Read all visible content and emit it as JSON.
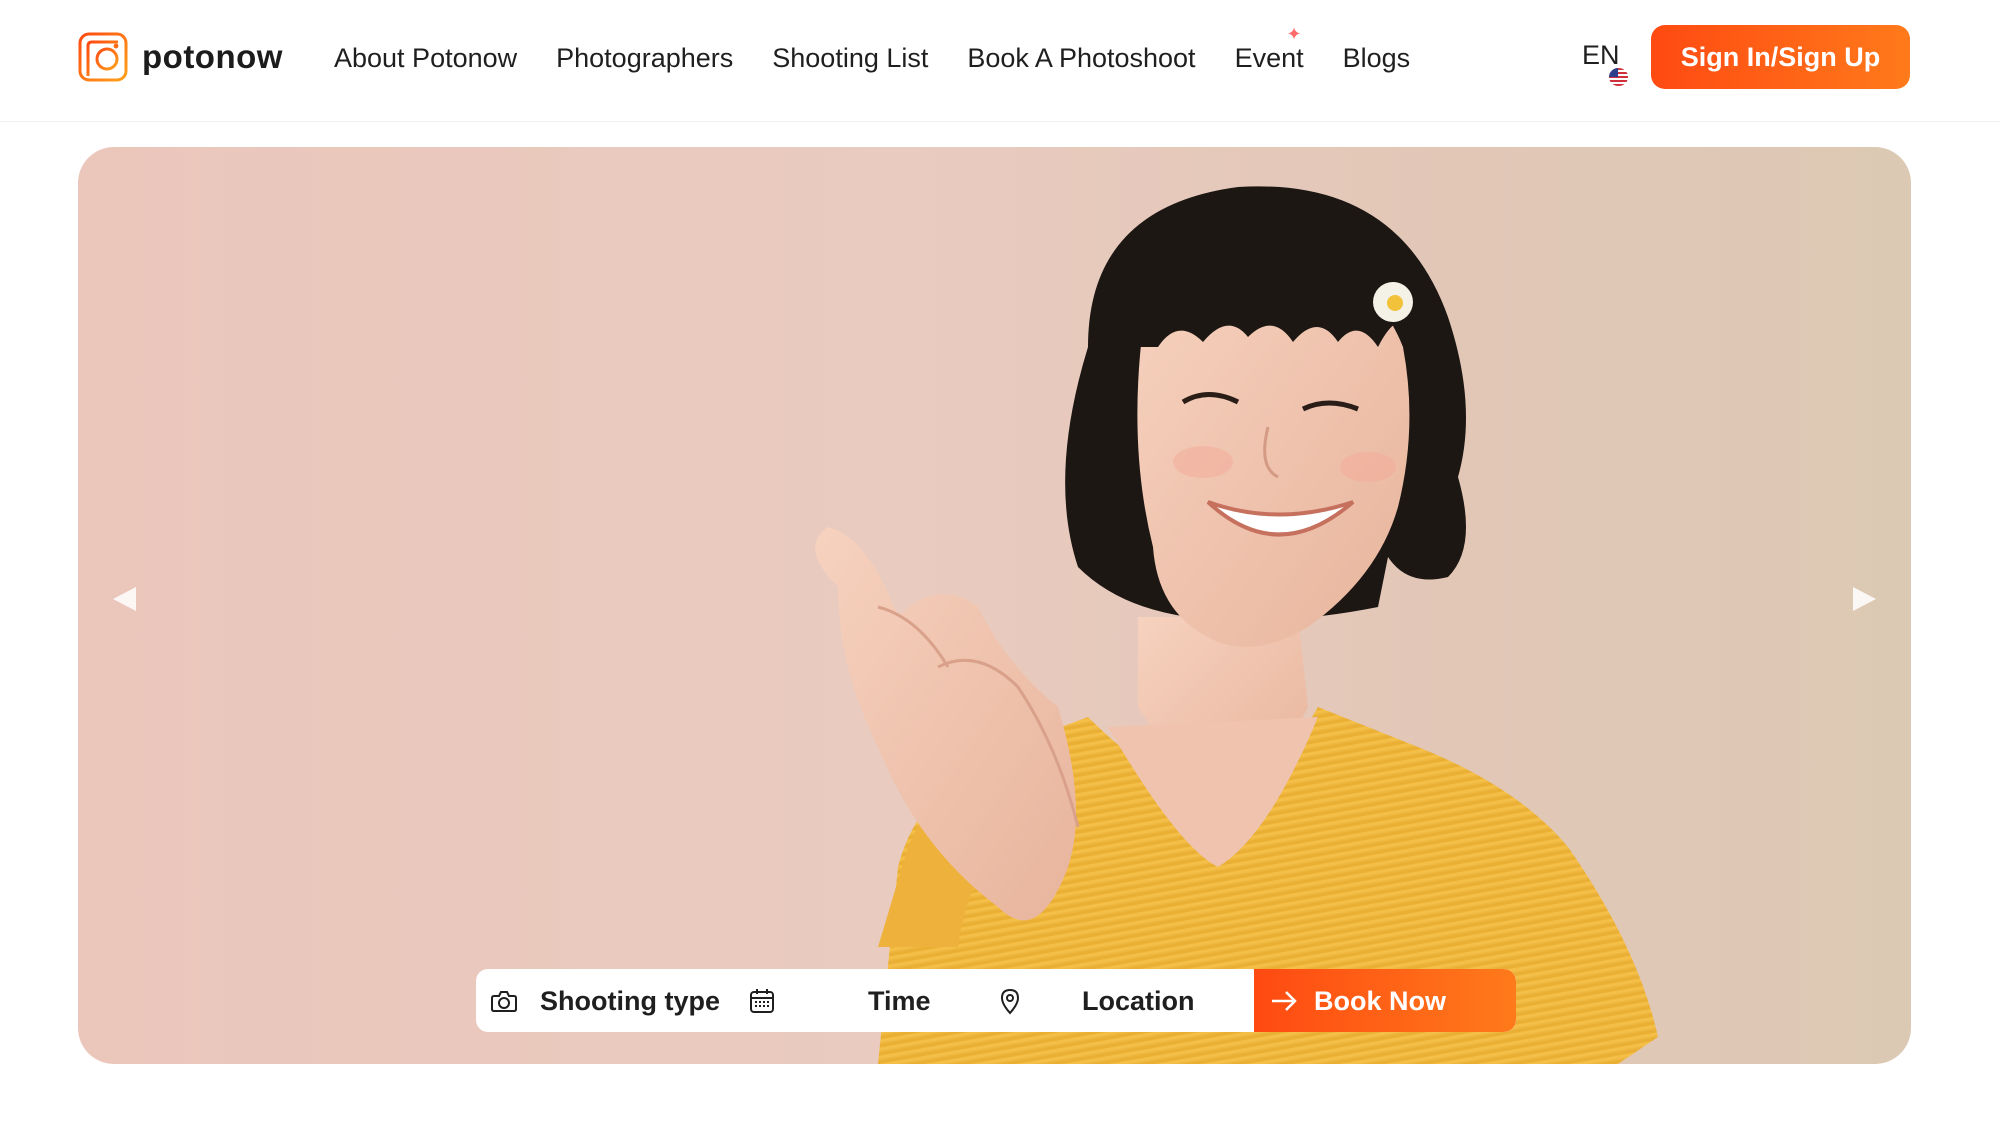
{
  "brand": {
    "name": "potonow",
    "accent": "#ff5a14"
  },
  "nav": {
    "items": [
      {
        "label": "About Potonow"
      },
      {
        "label": "Photographers"
      },
      {
        "label": "Shooting List"
      },
      {
        "label": "Book A Photoshoot"
      },
      {
        "label": "Event",
        "badge_icon": "sparkle-icon"
      },
      {
        "label": "Blogs"
      }
    ]
  },
  "language": {
    "label": "EN",
    "flag_icon": "us-flag-icon"
  },
  "auth": {
    "signin_label": "Sign In/Sign Up"
  },
  "hero": {
    "image": "portrait-photo",
    "prev_icon": "arrow-left-icon",
    "next_icon": "arrow-right-icon",
    "booking": {
      "shooting_type": {
        "label": "Shooting type",
        "icon": "camera-icon"
      },
      "time": {
        "label": "Time",
        "icon": "calendar-icon"
      },
      "location": {
        "label": "Location",
        "icon": "map-pin-icon"
      },
      "book_now": {
        "label": "Book Now",
        "icon": "arrow-right-icon"
      }
    }
  }
}
